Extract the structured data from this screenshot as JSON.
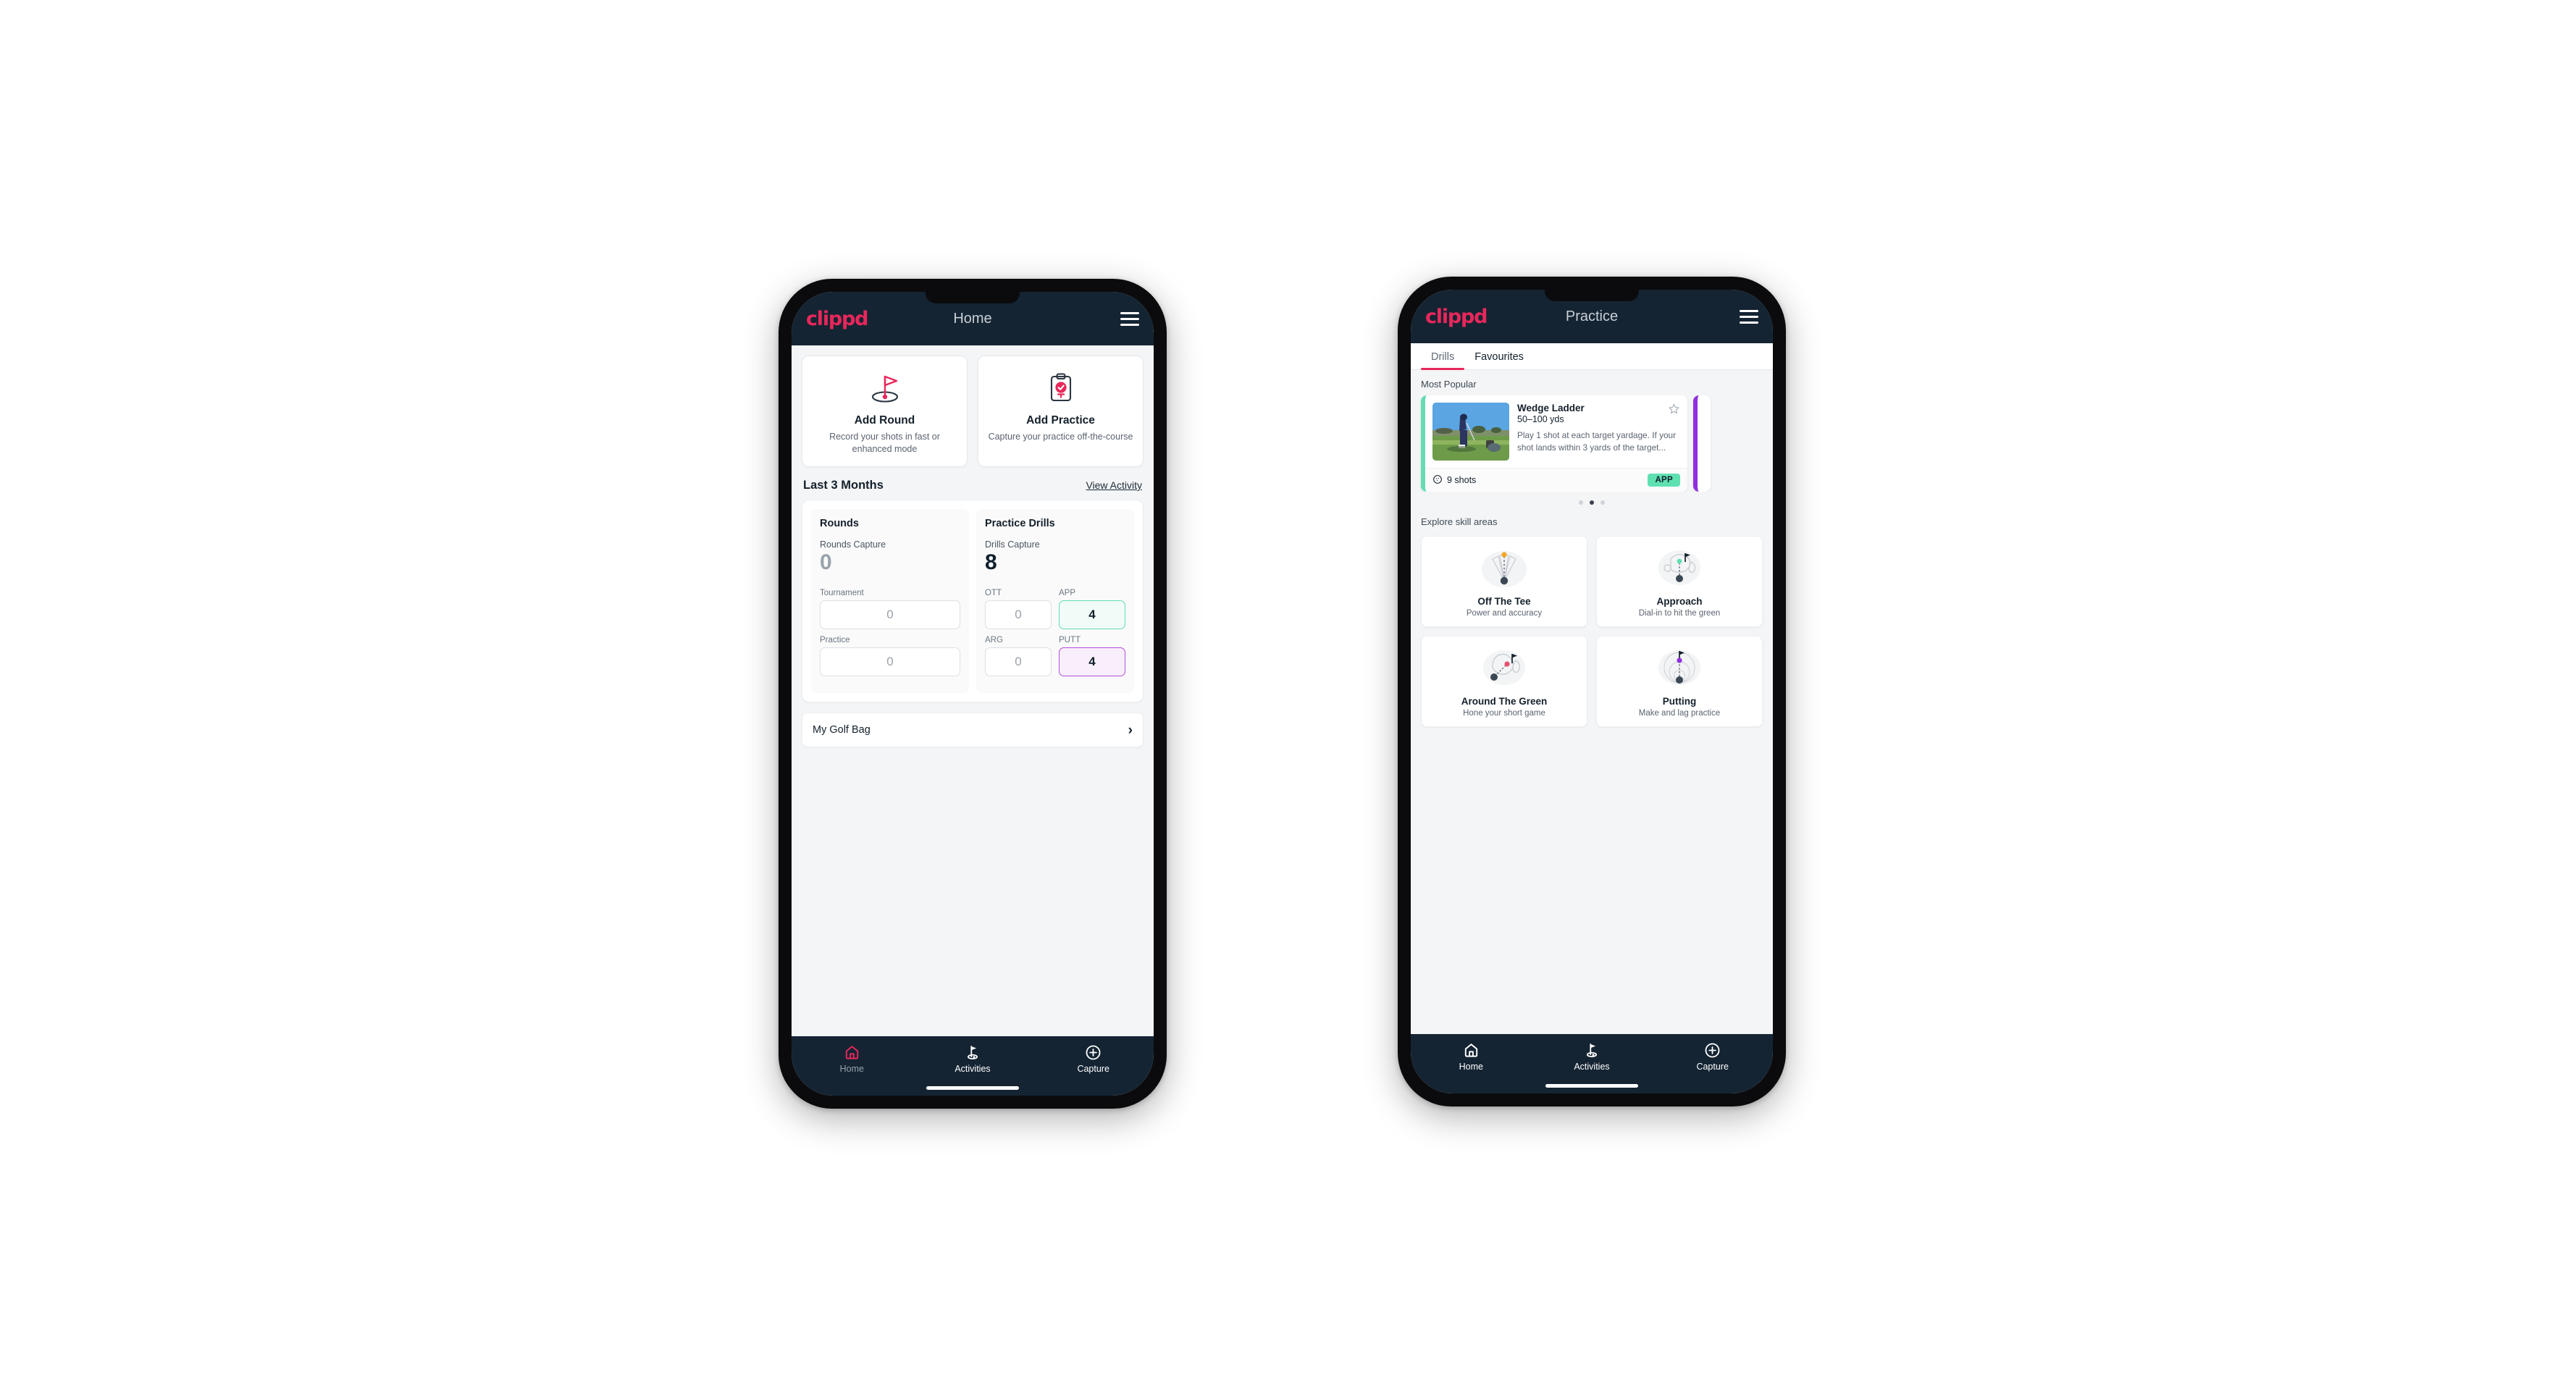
{
  "brand": {
    "logo_text": "clippd",
    "accent": "#e8275b",
    "appbar_bg": "#142433",
    "green": "#5fe0b1",
    "purple": "#8f2fe0"
  },
  "home_screen": {
    "appbar": {
      "title": "Home",
      "menu_icon": "hamburger-icon"
    },
    "actions": [
      {
        "icon": "golf-flag-hole-icon",
        "title": "Add Round",
        "subtitle": "Record your shots in fast or enhanced mode"
      },
      {
        "icon": "clipboard-check-icon",
        "title": "Add Practice",
        "subtitle": "Capture your practice off-the-course"
      }
    ],
    "section": {
      "title": "Last 3 Months",
      "link": "View Activity"
    },
    "rounds": {
      "heading": "Rounds",
      "capture_label": "Rounds Capture",
      "capture_value": "0",
      "fields": [
        {
          "label": "Tournament",
          "value": "0",
          "state": "zero"
        },
        {
          "label": "Practice",
          "value": "0",
          "state": "zero"
        }
      ]
    },
    "drills": {
      "heading": "Practice Drills",
      "capture_label": "Drills Capture",
      "capture_value": "8",
      "fields": [
        {
          "label": "OTT",
          "value": "0",
          "state": "zero"
        },
        {
          "label": "APP",
          "value": "4",
          "state": "green"
        },
        {
          "label": "ARG",
          "value": "0",
          "state": "zero"
        },
        {
          "label": "PUTT",
          "value": "4",
          "state": "purple"
        }
      ]
    },
    "golf_bag": {
      "label": "My Golf Bag",
      "chevron": "chevron-right-icon"
    },
    "bottom_nav": [
      {
        "icon": "home-icon",
        "label": "Home",
        "active": true
      },
      {
        "icon": "golf-flag-icon",
        "label": "Activities",
        "active": false
      },
      {
        "icon": "plus-circle-icon",
        "label": "Capture",
        "active": false
      }
    ]
  },
  "practice_screen": {
    "appbar": {
      "title": "Practice",
      "menu_icon": "hamburger-icon"
    },
    "tabs": [
      {
        "label": "Drills",
        "active": true
      },
      {
        "label": "Favourites",
        "active": false
      }
    ],
    "most_popular_label": "Most Popular",
    "drill": {
      "title": "Wedge Ladder",
      "yardage": "50–100 yds",
      "description": "Play 1 shot at each target yardage. If your shot lands within 3 yards of the target...",
      "shots": "9 shots",
      "shots_icon": "golf-ball-icon",
      "badge": "APP",
      "favourite_icon": "star-outline-icon",
      "accent": "#63dcb4",
      "next_card_accent": "#8f2fe0"
    },
    "carousel_dots": {
      "count": 3,
      "active_index": 1
    },
    "explore_label": "Explore skill areas",
    "skills": [
      {
        "icon": "tee-shot-fan-icon",
        "title": "Off The Tee",
        "subtitle": "Power and accuracy",
        "dot_color": "#f5a623"
      },
      {
        "icon": "approach-green-icon",
        "title": "Approach",
        "subtitle": "Dial-in to hit the green",
        "dot_color": "#5fe0b1"
      },
      {
        "icon": "chip-green-icon",
        "title": "Around The Green",
        "subtitle": "Hone your short game",
        "dot_color": "#e8275b"
      },
      {
        "icon": "putting-rings-icon",
        "title": "Putting",
        "subtitle": "Make and lag practice",
        "dot_color": "#8f2fe0"
      }
    ],
    "bottom_nav": [
      {
        "icon": "home-icon",
        "label": "Home",
        "active": false
      },
      {
        "icon": "golf-flag-icon",
        "label": "Activities",
        "active": true
      },
      {
        "icon": "plus-circle-icon",
        "label": "Capture",
        "active": false
      }
    ]
  }
}
